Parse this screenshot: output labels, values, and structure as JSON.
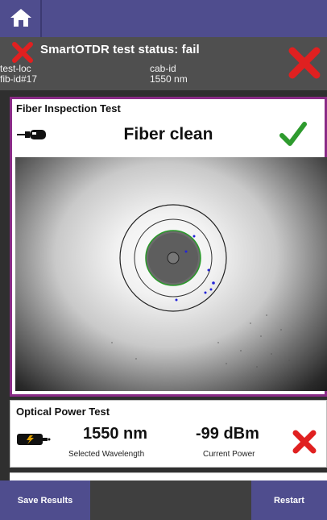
{
  "topbar": {
    "home_icon": "home-icon"
  },
  "status": {
    "title": "SmartOTDR test status: fail",
    "location": "test-loc",
    "fiber_id": "fib-id#17",
    "cable_id": "cab-id",
    "wavelength": "1550 nm",
    "status_color": "#e02020",
    "fail_icon": "close-icon"
  },
  "inspection": {
    "title": "Fiber Inspection Test",
    "result": "Fiber clean",
    "result_color": "#2e9b2e",
    "probe_icon": "fiber-probe-icon",
    "pass_icon": "checkmark-icon"
  },
  "power": {
    "title": "Optical Power Test",
    "wavelength_value": "1550 nm",
    "wavelength_label": "Selected Wavelength",
    "power_value": "-99 dBm",
    "power_label": "Current Power",
    "meter_icon": "power-meter-icon",
    "fail_icon": "close-icon"
  },
  "buttons": {
    "save": "Save Results",
    "restart": "Restart"
  },
  "colors": {
    "accent": "#4f4d8e",
    "panel_border": "#8a2b87"
  }
}
